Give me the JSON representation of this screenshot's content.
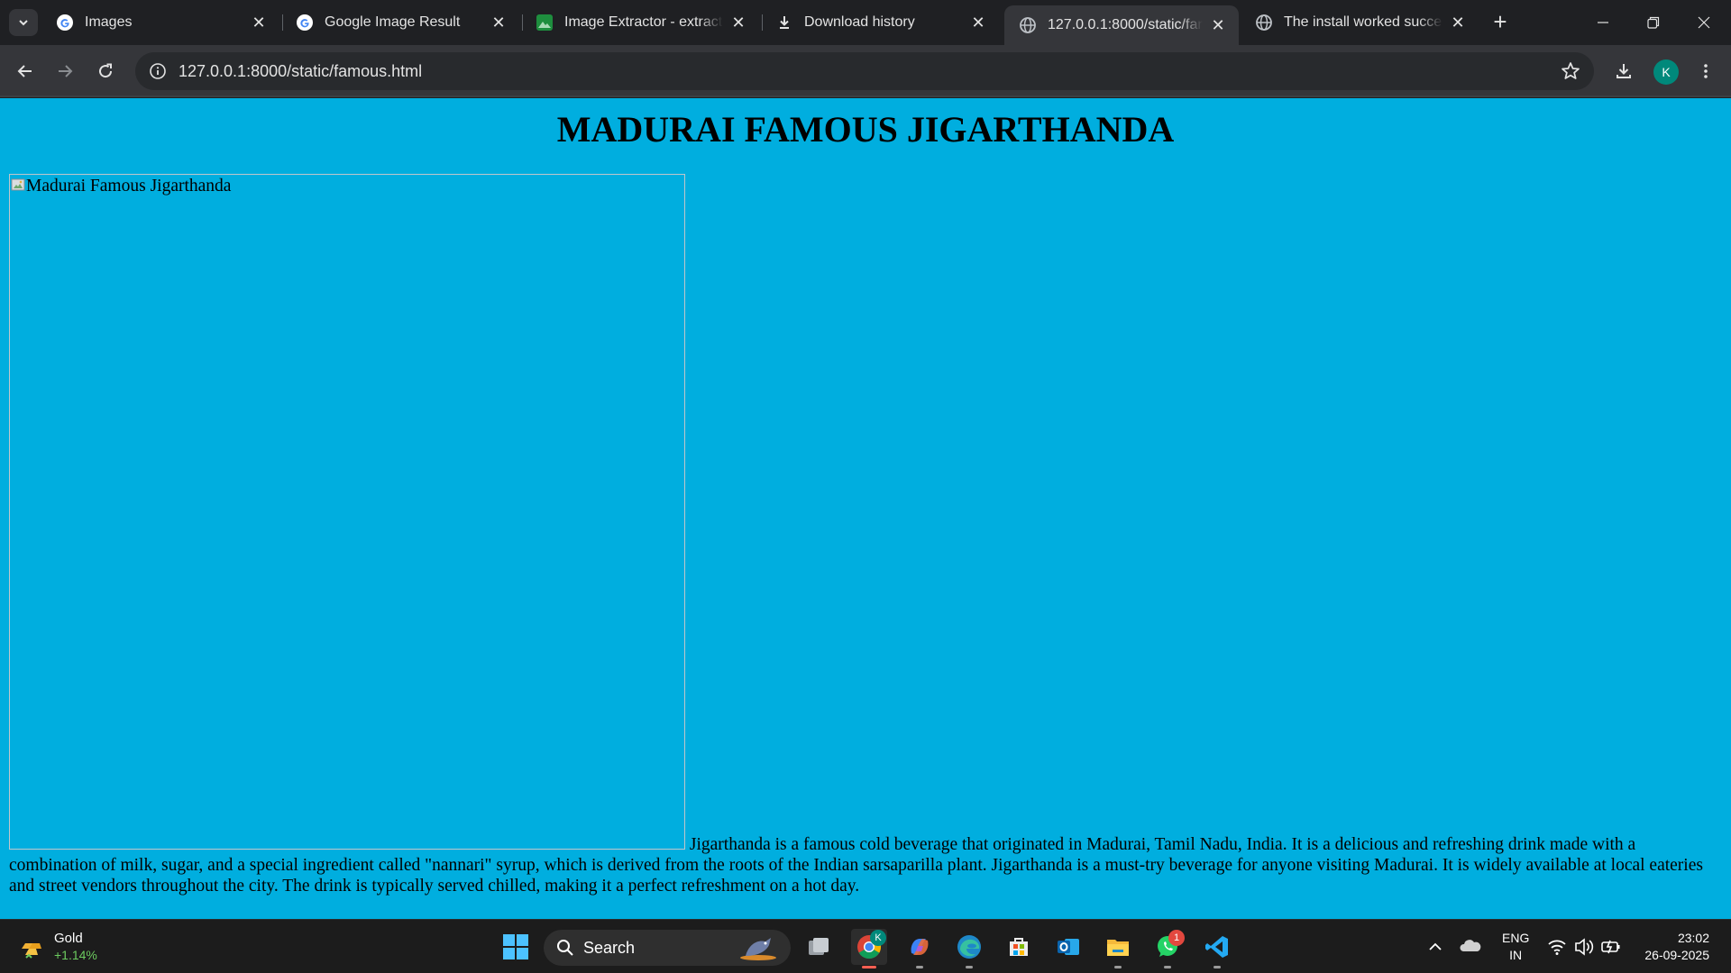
{
  "browser": {
    "tabs": [
      {
        "title": "Images",
        "favicon": "google-g-icon"
      },
      {
        "title": "Google Image Result",
        "favicon": "google-g-icon"
      },
      {
        "title": "Image Extractor - extract.pics",
        "favicon": "image-icon"
      },
      {
        "title": "Download history",
        "favicon": "download-icon"
      },
      {
        "title": "127.0.0.1:8000/static/famous.html",
        "favicon": "globe-icon",
        "active": true
      },
      {
        "title": "The install worked successfully",
        "favicon": "globe-icon"
      }
    ],
    "url": "127.0.0.1:8000/static/famous.html",
    "profile_initial": "K"
  },
  "page": {
    "heading": "MADURAI FAMOUS JIGARTHANDA",
    "image_alt": "Madurai Famous Jigarthanda",
    "description": "Jigarthanda is a famous cold beverage that originated in Madurai, Tamil Nadu, India. It is a delicious and refreshing drink made with a combination of milk, sugar, and a special ingredient called \"nannari\" syrup, which is derived from the roots of the Indian sarsaparilla plant. Jigarthanda is a must-try beverage for anyone visiting Madurai. It is widely available at local eateries and street vendors throughout the city. The drink is typically served chilled, making it a perfect refreshment on a hot day.",
    "background_color": "#00aedf"
  },
  "taskbar": {
    "widget": {
      "name": "Gold",
      "change": "+1.14%"
    },
    "search_label": "Search",
    "whatsapp_badge": "1",
    "chrome_badge": "K",
    "language": {
      "line1": "ENG",
      "line2": "IN"
    },
    "time": "23:02",
    "date": "26-09-2025"
  }
}
